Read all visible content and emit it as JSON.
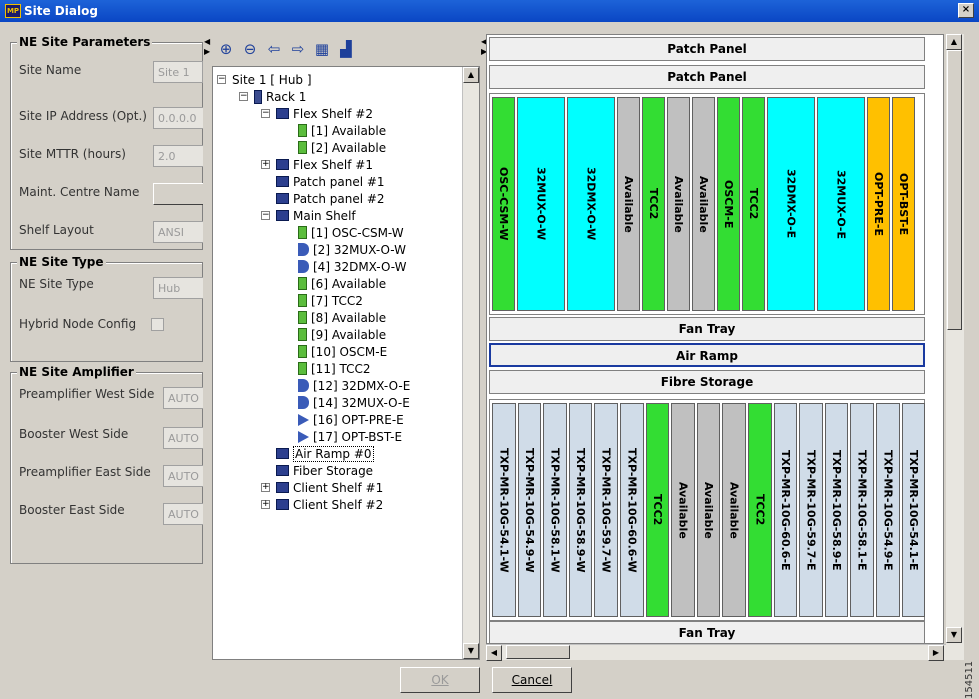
{
  "window": {
    "title": "Site Dialog",
    "logo_text": "MP",
    "close_symbol": "×"
  },
  "params": {
    "header": "NE Site Parameters",
    "site_name_label": "Site Name",
    "site_name_value": "Site 1",
    "site_ip_label": "Site IP Address (Opt.)",
    "site_ip_value": "0.0.0.0",
    "mttr_label": "Site MTTR (hours)",
    "mttr_value": "2.0",
    "maint_label": "Maint. Centre Name",
    "maint_value": "",
    "layout_label": "Shelf Layout",
    "layout_value": "ANSI"
  },
  "sitetype": {
    "header": "NE Site Type",
    "type_label": "NE Site Type",
    "type_value": "Hub",
    "hybrid_label": "Hybrid Node Config"
  },
  "amp": {
    "header": "NE Site Amplifier",
    "pre_west_label": "Preamplifier West Side",
    "pre_west_value": "AUTO",
    "boost_west_label": "Booster West Side",
    "boost_west_value": "AUTO",
    "pre_east_label": "Preamplifier East Side",
    "pre_east_value": "AUTO",
    "boost_east_label": "Booster East Side",
    "boost_east_value": "AUTO"
  },
  "toolbar": {
    "zoom_in": "zoom-in-icon",
    "zoom_out": "zoom-out-icon",
    "back": "back-arrow-icon",
    "forward": "forward-arrow-icon",
    "table": "table-icon",
    "chart": "chart-icon"
  },
  "tree": {
    "items": [
      {
        "label": "Site 1 [ Hub ]",
        "icon": "none",
        "exp": "−"
      },
      {
        "label": "Rack 1",
        "icon": "rack",
        "exp": "−"
      },
      {
        "label": "Flex Shelf #2",
        "icon": "shelf",
        "exp": "−"
      },
      {
        "label": "[1] Available",
        "icon": "card",
        "exp": ""
      },
      {
        "label": "[2] Available",
        "icon": "card",
        "exp": ""
      },
      {
        "label": "Flex Shelf #1",
        "icon": "shelf",
        "exp": "+"
      },
      {
        "label": "Patch panel #1",
        "icon": "shelf",
        "exp": ""
      },
      {
        "label": "Patch panel #2",
        "icon": "shelf",
        "exp": ""
      },
      {
        "label": "Main Shelf",
        "icon": "shelf",
        "exp": "−"
      },
      {
        "label": "[1] OSC-CSM-W",
        "icon": "card",
        "exp": ""
      },
      {
        "label": "[2] 32MUX-O-W",
        "icon": "filt",
        "exp": ""
      },
      {
        "label": "[4] 32DMX-O-W",
        "icon": "filt",
        "exp": ""
      },
      {
        "label": "[6] Available",
        "icon": "card",
        "exp": ""
      },
      {
        "label": "[7] TCC2",
        "icon": "card",
        "exp": ""
      },
      {
        "label": "[8] Available",
        "icon": "card",
        "exp": ""
      },
      {
        "label": "[9] Available",
        "icon": "card",
        "exp": ""
      },
      {
        "label": "[10] OSCM-E",
        "icon": "card",
        "exp": ""
      },
      {
        "label": "[11] TCC2",
        "icon": "card",
        "exp": ""
      },
      {
        "label": "[12] 32DMX-O-E",
        "icon": "filt",
        "exp": ""
      },
      {
        "label": "[14] 32MUX-O-E",
        "icon": "filt",
        "exp": ""
      },
      {
        "label": "[16] OPT-PRE-E",
        "icon": "amp",
        "exp": ""
      },
      {
        "label": "[17] OPT-BST-E",
        "icon": "amp",
        "exp": ""
      },
      {
        "label": "Air Ramp #0",
        "icon": "shelf",
        "exp": ""
      },
      {
        "label": "Fiber Storage",
        "icon": "shelf",
        "exp": ""
      },
      {
        "label": "Client Shelf #1",
        "icon": "shelf",
        "exp": "+"
      },
      {
        "label": "Client Shelf #2",
        "icon": "shelf",
        "exp": "+"
      }
    ]
  },
  "view": {
    "patch1": "Patch Panel",
    "patch2": "Patch Panel",
    "fan1": "Fan Tray",
    "air": "Air Ramp",
    "fibre": "Fibre Storage",
    "fan2": "Fan Tray",
    "main_slots": [
      {
        "label": "OSC-CSM-W",
        "color": "#33dd33",
        "w": 1
      },
      {
        "label": "32MUX-O-W",
        "color": "#00ffff",
        "w": 2
      },
      {
        "label": "32DMX-O-W",
        "color": "#00ffff",
        "w": 2
      },
      {
        "label": "Available",
        "color": "#c0c0c0",
        "w": 1
      },
      {
        "label": "TCC2",
        "color": "#33dd33",
        "w": 1
      },
      {
        "label": "Available",
        "color": "#c0c0c0",
        "w": 1
      },
      {
        "label": "Available",
        "color": "#c0c0c0",
        "w": 1
      },
      {
        "label": "OSCM-E",
        "color": "#33dd33",
        "w": 1
      },
      {
        "label": "TCC2",
        "color": "#33dd33",
        "w": 1
      },
      {
        "label": "32DMX-O-E",
        "color": "#00ffff",
        "w": 2
      },
      {
        "label": "32MUX-O-E",
        "color": "#00ffff",
        "w": 2
      },
      {
        "label": "OPT-PRE-E",
        "color": "#ffc000",
        "w": 1
      },
      {
        "label": "OPT-BST-E",
        "color": "#ffc000",
        "w": 1
      }
    ],
    "client_slots": [
      {
        "label": "TXP-MR-10G-54.1-W",
        "color": "#d0dce8"
      },
      {
        "label": "TXP-MR-10G-54.9-W",
        "color": "#d0dce8"
      },
      {
        "label": "TXP-MR-10G-58.1-W",
        "color": "#d0dce8"
      },
      {
        "label": "TXP-MR-10G-58.9-W",
        "color": "#d0dce8"
      },
      {
        "label": "TXP-MR-10G-59.7-W",
        "color": "#d0dce8"
      },
      {
        "label": "TXP-MR-10G-60.6-W",
        "color": "#d0dce8"
      },
      {
        "label": "TCC2",
        "color": "#33dd33"
      },
      {
        "label": "Available",
        "color": "#c0c0c0"
      },
      {
        "label": "Available",
        "color": "#c0c0c0"
      },
      {
        "label": "Available",
        "color": "#c0c0c0"
      },
      {
        "label": "TCC2",
        "color": "#33dd33"
      },
      {
        "label": "TXP-MR-10G-60.6-E",
        "color": "#d0dce8"
      },
      {
        "label": "TXP-MR-10G-59.7-E",
        "color": "#d0dce8"
      },
      {
        "label": "TXP-MR-10G-58.9-E",
        "color": "#d0dce8"
      },
      {
        "label": "TXP-MR-10G-58.1-E",
        "color": "#d0dce8"
      },
      {
        "label": "TXP-MR-10G-54.9-E",
        "color": "#d0dce8"
      },
      {
        "label": "TXP-MR-10G-54.1-E",
        "color": "#d0dce8"
      }
    ]
  },
  "buttons": {
    "ok": "OK",
    "cancel": "Cancel"
  },
  "figure_id": "154511"
}
